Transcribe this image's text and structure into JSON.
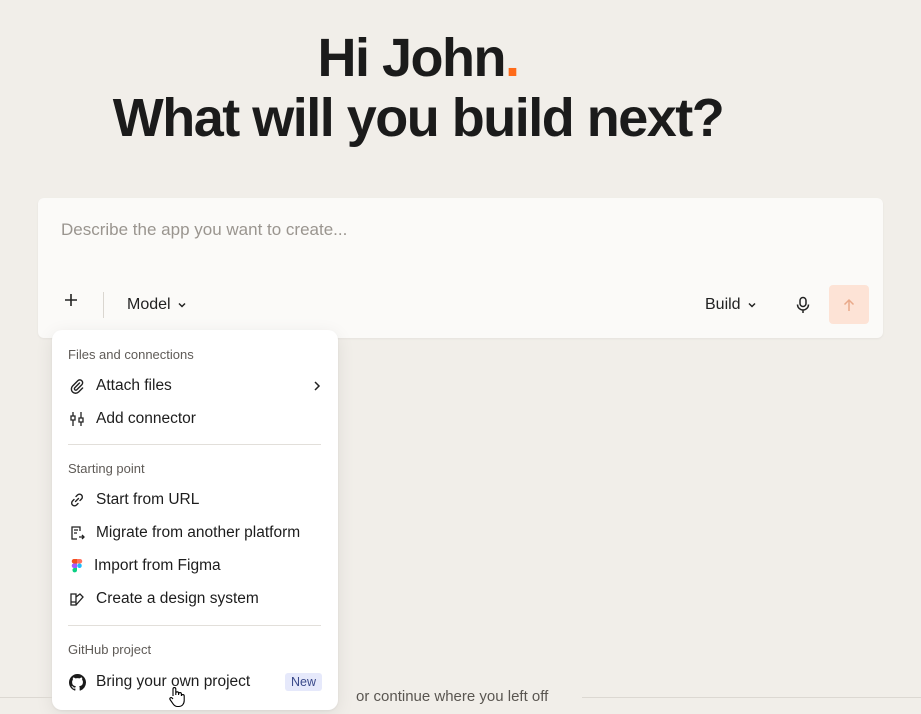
{
  "hero": {
    "greeting": "Hi John",
    "greeting_dot": ".",
    "headline": "What will you build next?"
  },
  "prompt": {
    "placeholder": "Describe the app you want to create...",
    "plus_icon": "plus-icon",
    "model_label": "Model",
    "build_label": "Build",
    "mic_icon": "microphone-icon",
    "send_icon": "arrow-up-icon"
  },
  "menu": {
    "sections": [
      {
        "title": "Files and connections",
        "items": [
          {
            "label": "Attach files",
            "icon": "paperclip-icon",
            "has_submenu": true
          },
          {
            "label": "Add connector",
            "icon": "connector-icon"
          }
        ]
      },
      {
        "title": "Starting point",
        "items": [
          {
            "label": "Start from URL",
            "icon": "link-icon"
          },
          {
            "label": "Migrate from another platform",
            "icon": "migrate-icon"
          },
          {
            "label": "Import from Figma",
            "icon": "figma-icon"
          },
          {
            "label": "Create a design system",
            "icon": "design-system-icon"
          }
        ]
      },
      {
        "title": "GitHub project",
        "items": [
          {
            "label": "Bring your own project",
            "icon": "github-icon",
            "badge": "New"
          }
        ]
      }
    ]
  },
  "footer": {
    "continue_text": "or continue where you left off"
  },
  "colors": {
    "background": "#f1eee9",
    "accent": "#ff6b1a",
    "send_bg": "#fde3d6"
  }
}
